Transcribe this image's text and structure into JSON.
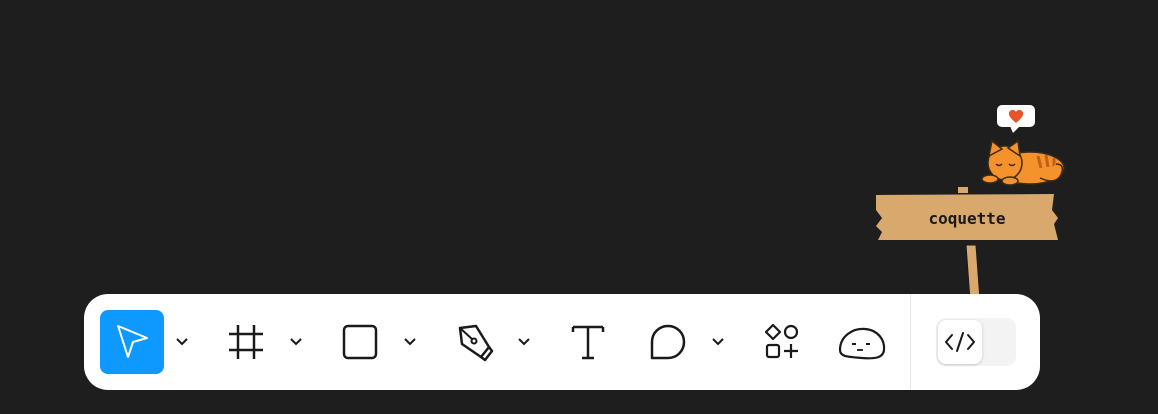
{
  "toolbar": {
    "tools": [
      {
        "id": "move",
        "icon": "cursor-arrow-icon",
        "active": true
      },
      {
        "id": "frame",
        "icon": "frame-hash-icon"
      },
      {
        "id": "shape",
        "icon": "rectangle-icon"
      },
      {
        "id": "pen",
        "icon": "pen-tool-icon"
      },
      {
        "id": "text",
        "icon": "text-t-icon"
      },
      {
        "id": "comment",
        "icon": "speech-bubble-icon"
      },
      {
        "id": "assets",
        "icon": "shapes-plus-icon"
      },
      {
        "id": "widget",
        "icon": "sleepy-blob-icon"
      }
    ],
    "dev_mode_toggle": {
      "icon": "code-brackets-icon",
      "on": false
    }
  },
  "decoration": {
    "sign_text": "coquette",
    "cat_icon": "sleeping-cat-icon",
    "speech_icon": "heart-speech-bubble-icon"
  },
  "colors": {
    "canvas": "#1e1e1e",
    "toolbar": "#ffffff",
    "active_tool": "#0d99ff",
    "sign": "#d9a86c",
    "cat": "#f5922b",
    "heart": "#e8542a"
  }
}
